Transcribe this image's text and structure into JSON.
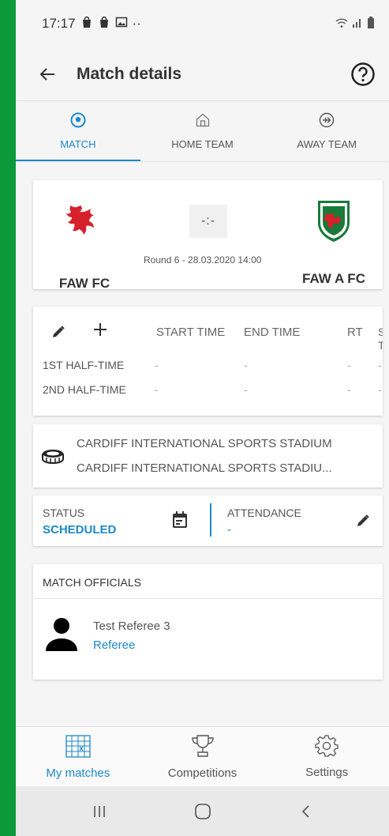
{
  "statusbar": {
    "time": "17:17",
    "dots": "··"
  },
  "appbar": {
    "title": "Match details"
  },
  "tabs": [
    {
      "label": "MATCH",
      "icon": "soccer-ball-icon",
      "active": true
    },
    {
      "label": "HOME TEAM",
      "icon": "home-icon",
      "active": false
    },
    {
      "label": "AWAY TEAM",
      "icon": "airplane-icon",
      "active": false
    }
  ],
  "match": {
    "home_team": "FAW FC",
    "away_team": "FAW A FC",
    "score": "-:-",
    "round_info": "Round 6 - 28.03.2020 14:00"
  },
  "times": {
    "headers": {
      "start": "START TIME",
      "end": "END TIME",
      "rt": "RT",
      "st_line1": "S",
      "st_line2": "T"
    },
    "rows": [
      {
        "label": "1ST HALF-TIME",
        "start": "-",
        "end": "-",
        "rt": "-",
        "st": "-"
      },
      {
        "label": "2ND HALF-TIME",
        "start": "-",
        "end": "-",
        "rt": "-",
        "st": "-"
      }
    ]
  },
  "stadium": {
    "line1": "CARDIFF INTERNATIONAL SPORTS STADIUM",
    "line2": "CARDIFF INTERNATIONAL SPORTS STADIU..."
  },
  "status": {
    "status_label": "STATUS",
    "status_value": "SCHEDULED",
    "attendance_label": "ATTENDANCE",
    "attendance_value": "-"
  },
  "officials": {
    "header": "MATCH OFFICIALS",
    "items": [
      {
        "name": "Test Referee 3",
        "role": "Referee"
      }
    ]
  },
  "bottomnav": [
    {
      "label": "My matches",
      "icon": "calendar-grid-icon",
      "active": true
    },
    {
      "label": "Competitions",
      "icon": "trophy-icon",
      "active": false
    },
    {
      "label": "Settings",
      "icon": "gear-icon",
      "active": false
    }
  ],
  "colors": {
    "accent": "#1e88c7",
    "frame": "#0a9a3a",
    "crest_red": "#d6202a"
  }
}
